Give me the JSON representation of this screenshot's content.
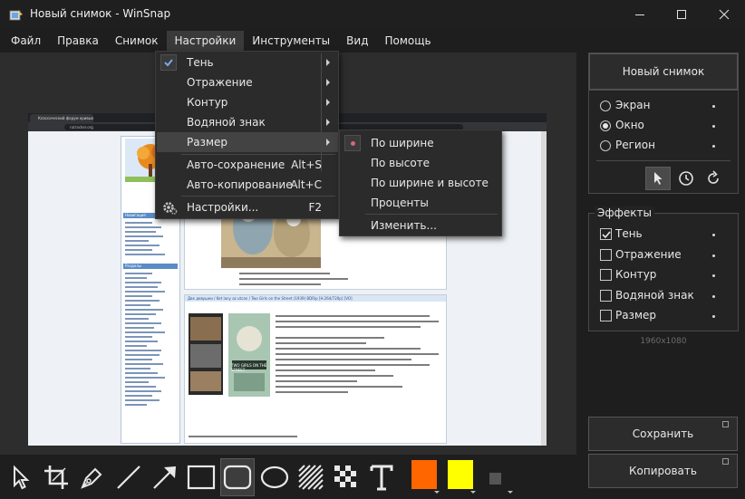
{
  "window": {
    "title": "Новый снимок - WinSnap"
  },
  "menubar": {
    "items": [
      "Файл",
      "Правка",
      "Снимок",
      "Настройки",
      "Инструменты",
      "Вид",
      "Помощь"
    ]
  },
  "settings_menu": {
    "items": [
      {
        "label": "Тень",
        "checked": true,
        "submenu": true
      },
      {
        "label": "Отражение",
        "submenu": true
      },
      {
        "label": "Контур",
        "submenu": true
      },
      {
        "label": "Водяной знак",
        "submenu": true
      },
      {
        "label": "Размер",
        "submenu": true,
        "highlighted": true
      },
      {
        "label": "Авто-сохранение",
        "shortcut": "Alt+S"
      },
      {
        "label": "Авто-копирование",
        "shortcut": "Alt+C"
      },
      {
        "label": "Настройки...",
        "shortcut": "F2",
        "icon": "gear-icon"
      }
    ]
  },
  "size_submenu": {
    "items": [
      {
        "label": "По ширине",
        "selected": true
      },
      {
        "label": "По высоте"
      },
      {
        "label": "По ширине и высоте"
      },
      {
        "label": "Проценты"
      },
      {
        "label": "Изменить..."
      }
    ]
  },
  "screenshot_preview": {
    "tab_title": "Классический форум кривых",
    "url": "rutracker.org",
    "nav_heading": "Навигация",
    "sections_heading": "Разделы",
    "post_title": "Две девушки / Ket lany az utcan / Two Girls on the Street (1939) BDRip [H.264/720p] [VO]",
    "poster_text": "TWO GIRLS ON THE STREET"
  },
  "right_panel": {
    "new_shot_label": "Новый снимок",
    "capture_modes": [
      {
        "label": "Экран",
        "selected": false
      },
      {
        "label": "Окно",
        "selected": true
      },
      {
        "label": "Регион",
        "selected": false
      }
    ],
    "effects_title": "Эффекты",
    "effects": [
      {
        "label": "Тень",
        "checked": true
      },
      {
        "label": "Отражение",
        "checked": false
      },
      {
        "label": "Контур",
        "checked": false
      },
      {
        "label": "Водяной знак",
        "checked": false
      },
      {
        "label": "Размер",
        "checked": false
      }
    ],
    "resolution": "1960x1080",
    "save_label": "Сохранить",
    "copy_label": "Копировать"
  },
  "toolbar": {
    "tools": [
      "pointer-icon",
      "crop-icon",
      "pen-icon",
      "line-icon",
      "arrow-icon",
      "rectangle-icon",
      "rounded-rectangle-icon",
      "ellipse-icon",
      "hatch-icon",
      "pixelate-icon",
      "text-icon"
    ],
    "active_tool": "rounded-rectangle-icon",
    "primary_color": "#ff6600",
    "secondary_color": "#ffff00"
  }
}
